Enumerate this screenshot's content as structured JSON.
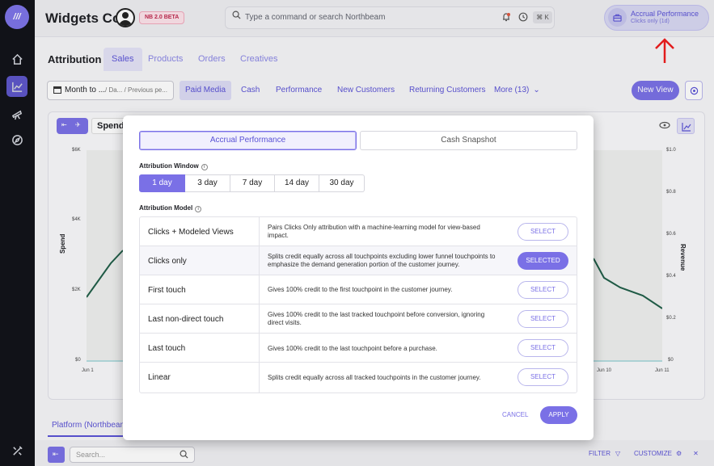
{
  "topbar": {
    "company": "Widgets Co",
    "beta_badge": "NB 2.0 BETA",
    "command_placeholder": "Type a command or search Northbeam",
    "shortcut": "⌘ K",
    "accrual_title": "Accrual Performance",
    "accrual_sub": "Clicks only (1d)"
  },
  "tabs": {
    "section": "Attribution",
    "items": [
      "Sales",
      "Products",
      "Orders",
      "Creatives"
    ],
    "active": "Sales"
  },
  "filters": {
    "date_main": "Month to ...",
    "date_sub": "/ Da... / Previous pe...",
    "segments": [
      "Paid Media",
      "Cash",
      "Performance",
      "New Customers",
      "Returning Customers",
      "More (13)"
    ],
    "active_segment": "Paid Media",
    "new_view": "New View"
  },
  "chart": {
    "metric_label": "Spend"
  },
  "chart_data": {
    "type": "line",
    "left_axis": {
      "label": "Spend",
      "ticks": [
        "$6K",
        "$4K",
        "$2K",
        "$0"
      ]
    },
    "right_axis": {
      "label": "Revenue",
      "ticks": [
        "$1.0",
        "$0.8",
        "$0.6",
        "$0.4",
        "$0.2",
        "$0"
      ]
    },
    "x_ticks": [
      "Jun 1",
      "Jun 10",
      "Jun 11"
    ]
  },
  "bottom": {
    "platform_tab": "Platform (Northbeam)",
    "search_placeholder": "Search...",
    "filter": "FILTER",
    "customize": "CUSTOMIZE"
  },
  "modal": {
    "tab_accrual": "Accrual Performance",
    "tab_cash": "Cash Snapshot",
    "window_label": "Attribution Window",
    "windows": [
      "1 day",
      "3 day",
      "7 day",
      "14 day",
      "30 day"
    ],
    "active_window": "1 day",
    "model_label": "Attribution Model",
    "models": [
      {
        "name": "Clicks + Modeled Views",
        "desc": "Pairs Clicks Only attribution with a machine-learning model for view-based impact.",
        "button": "SELECT"
      },
      {
        "name": "Clicks only",
        "desc": "Splits credit equally across all touchpoints excluding lower funnel touchpoints to emphasize the demand generation portion of the customer journey.",
        "button": "SELECTED"
      },
      {
        "name": "First touch",
        "desc": "Gives 100% credit to the first touchpoint in the customer journey.",
        "button": "SELECT"
      },
      {
        "name": "Last non-direct touch",
        "desc": "Gives 100% credit to the last tracked touchpoint before conversion, ignoring direct visits.",
        "button": "SELECT"
      },
      {
        "name": "Last touch",
        "desc": "Gives 100% credit to the last touchpoint before a purchase.",
        "button": "SELECT"
      },
      {
        "name": "Linear",
        "desc": "Splits credit equally across all tracked touchpoints in the customer journey.",
        "button": "SELECT"
      }
    ],
    "cancel": "CANCEL",
    "apply": "APPLY"
  }
}
